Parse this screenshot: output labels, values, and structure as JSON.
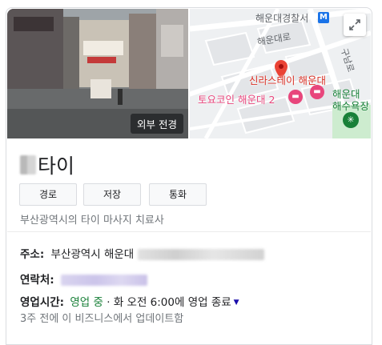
{
  "photo": {
    "label": "외부 전경"
  },
  "map": {
    "labels": {
      "station": "해운대경찰서",
      "street1": "해운대로",
      "street2": "구남로",
      "pin_name": "신라스테이 해운대",
      "hotel": "토요코인 해운대 2",
      "beach_line1": "해운대",
      "beach_line2": "해수욕장"
    },
    "metro_badge": "M",
    "colors": {
      "pin": "#ea4335",
      "hotel": "#e8467c",
      "beach": "#188038",
      "metro": "#1a73e8"
    }
  },
  "business": {
    "name_visible": "타이",
    "category": "부산광역시의 타이 마사지 치료사"
  },
  "actions": {
    "directions": "경로",
    "save": "저장",
    "call": "통화"
  },
  "details": {
    "address_label": "주소:",
    "address_value": "부산광역시 해운대",
    "phone_label": "연락처:",
    "hours_label": "영업시간:",
    "hours_status": "영업 중",
    "hours_sep": " · ",
    "hours_detail": "화 오전 6:00에 영업 종료",
    "updated": "3주 전에 이 비즈니스에서 업데이트함"
  }
}
